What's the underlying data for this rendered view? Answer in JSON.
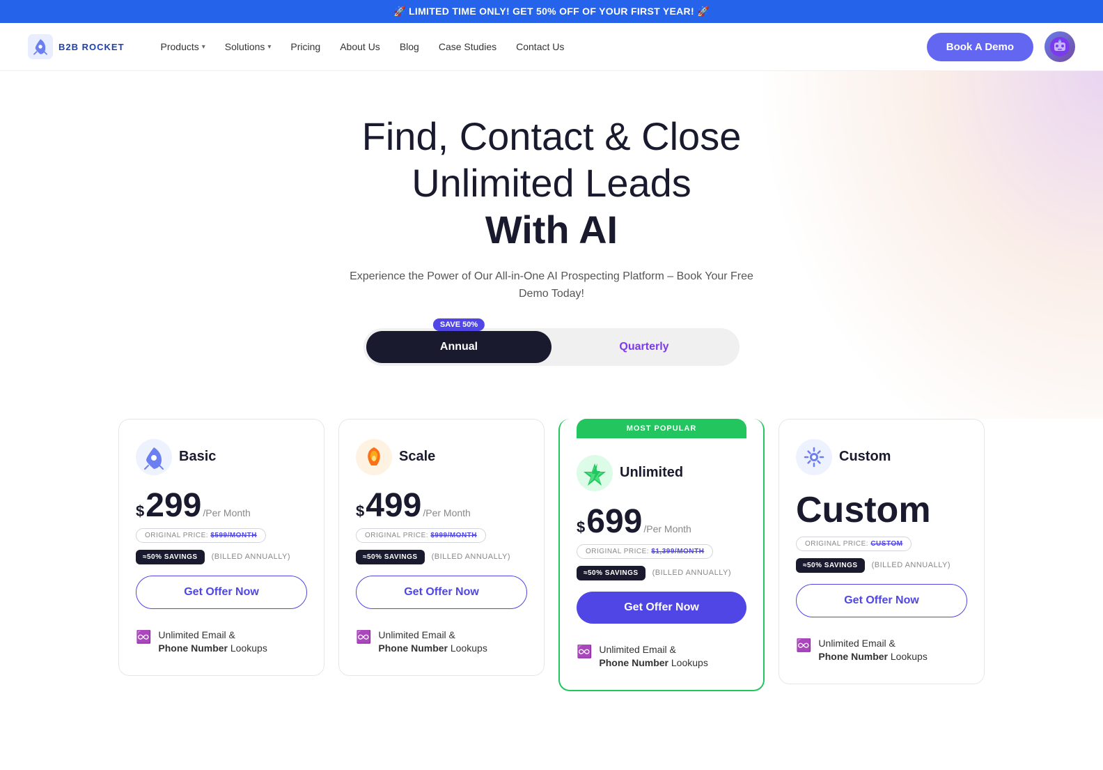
{
  "banner": {
    "text": "🚀 LIMITED TIME ONLY! GET 50% OFF OF YOUR FIRST YEAR! 🚀"
  },
  "nav": {
    "logo_text": "B2B ROCKET",
    "links": [
      {
        "label": "Products",
        "has_dropdown": true
      },
      {
        "label": "Solutions",
        "has_dropdown": true
      },
      {
        "label": "Pricing",
        "has_dropdown": false
      },
      {
        "label": "About Us",
        "has_dropdown": false
      },
      {
        "label": "Blog",
        "has_dropdown": false
      },
      {
        "label": "Case Studies",
        "has_dropdown": false
      },
      {
        "label": "Contact Us",
        "has_dropdown": false
      }
    ],
    "cta_label": "Book A Demo"
  },
  "hero": {
    "title_line1": "Find, Contact & Close",
    "title_line2": "Unlimited Leads",
    "title_line3": "With AI",
    "subtitle": "Experience the Power of Our All-in-One AI Prospecting Platform – Book Your Free Demo Today!"
  },
  "toggle": {
    "save_badge": "SAVE 50%",
    "annual_label": "Annual",
    "quarterly_label": "Quarterly"
  },
  "plans": [
    {
      "id": "basic",
      "name": "Basic",
      "icon_emoji": "🚀",
      "icon_color": "#6b7ff0",
      "price": "299",
      "period": "/Per Month",
      "original_label": "ORIGINAL PRICE:",
      "original_price": "$599/MONTH",
      "savings_label": "≈50% SAVINGS",
      "billed": "(BILLED ANNUALLY)",
      "cta": "Get Offer Now",
      "popular": false,
      "feature_icon": "♾️",
      "feature_text1": "Unlimited Email &",
      "feature_text2": "Phone Number",
      "feature_text3": "Lookups"
    },
    {
      "id": "scale",
      "name": "Scale",
      "icon_emoji": "🔥",
      "price": "499",
      "period": "/Per Month",
      "original_label": "ORIGINAL PRICE:",
      "original_price": "$999/MONTH",
      "savings_label": "≈50% SAVINGS",
      "billed": "(BILLED ANNUALLY)",
      "cta": "Get Offer Now",
      "popular": false,
      "feature_icon": "♾️",
      "feature_text1": "Unlimited Email &",
      "feature_text2": "Phone Number",
      "feature_text3": "Lookups"
    },
    {
      "id": "unlimited",
      "name": "Unlimited",
      "icon_emoji": "⚡",
      "icon_color": "#22c55e",
      "price": "699",
      "period": "/Per Month",
      "original_label": "ORIGINAL PRICE:",
      "original_price": "$1,399/MONTH",
      "savings_label": "≈50% SAVINGS",
      "billed": "(BILLED ANNUALLY)",
      "cta": "Get Offer Now",
      "popular": true,
      "popular_label": "MOST POPULAR",
      "feature_icon": "♾️",
      "feature_text1": "Unlimited Email &",
      "feature_text2": "Phone Number",
      "feature_text3": "Lookups"
    },
    {
      "id": "custom",
      "name": "Custom",
      "icon_emoji": "⚙️",
      "price_label": "Custom",
      "original_label": "ORIGINAL PRICE:",
      "original_price": "CUSTOM",
      "savings_label": "≈50% SAVINGS",
      "billed": "(BILLED ANNUALLY)",
      "cta": "Get Offer Now",
      "popular": false,
      "feature_icon": "♾️",
      "feature_text1": "Unlimited Email &",
      "feature_text2": "Phone Number",
      "feature_text3": "Lookups"
    }
  ]
}
